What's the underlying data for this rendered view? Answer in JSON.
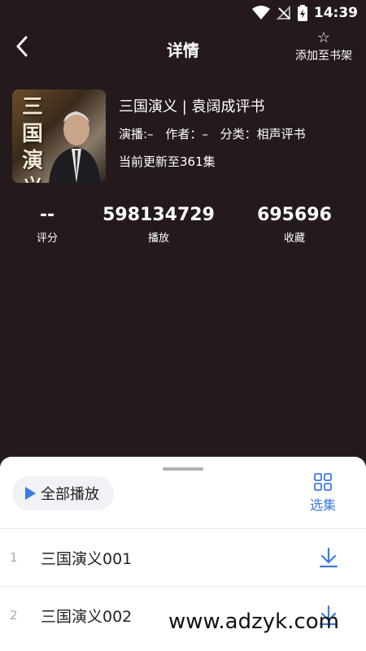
{
  "status_bar": {
    "time": "14:39"
  },
  "nav": {
    "title": "详情",
    "favorite_label": "添加至书架",
    "favorite_icon": "☆"
  },
  "book": {
    "cover_title": "三国演义",
    "title": "三国演义 | 袁阔成评书",
    "narrator": "演播:–",
    "author": "作者：–",
    "category": "分类：相声评书",
    "update": "当前更新至361集"
  },
  "stats": [
    {
      "value": "--",
      "label": "评分"
    },
    {
      "value": "598134729",
      "label": "播放"
    },
    {
      "value": "695696",
      "label": "收藏"
    }
  ],
  "sheet": {
    "play_all": "全部播放",
    "select_episodes": "选集",
    "episodes": [
      {
        "index": "1",
        "name": "三国演义001"
      },
      {
        "index": "2",
        "name": "三国演义002"
      }
    ]
  },
  "watermark": "www.adzyk.com",
  "colors": {
    "background": "#241a1b",
    "accent": "#3d7be0",
    "sheet": "#ffffff"
  }
}
